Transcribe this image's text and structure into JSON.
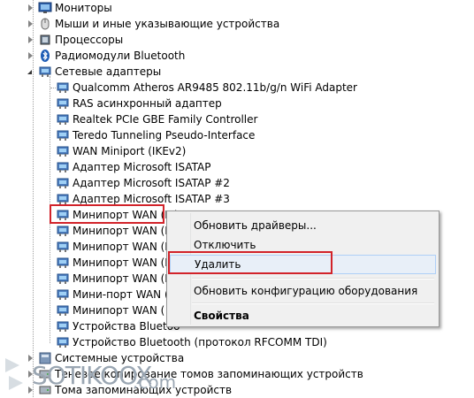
{
  "tree": {
    "categories_top": [
      {
        "label": "Мониторы",
        "icon": "monitor-icon"
      },
      {
        "label": "Мыши и иные указывающие устройства",
        "icon": "mouse-icon"
      },
      {
        "label": "Процессоры",
        "icon": "processor-icon"
      },
      {
        "label": "Радиомодули Bluetooth",
        "icon": "bluetooth-icon"
      },
      {
        "label": "Сетевые адаптеры",
        "icon": "network-adapter-icon"
      }
    ],
    "adapters": [
      "Qualcomm Atheros AR9485 802.11b/g/n WiFi Adapter",
      "RAS асинхронный адаптер",
      "Realtek PCIe GBE Family Controller",
      "Teredo Tunneling Pseudo-Interface",
      "WAN Miniport (IKEv2)",
      "Адаптер Microsoft ISATAP",
      "Адаптер Microsoft ISATAP #2",
      "Адаптер Microsoft ISATAP #3",
      "Минипорт WAN (IP)",
      "Минипорт WAN (I",
      "Минипорт WAN (L",
      "Минипорт WAN (P",
      "Минипорт WAN (P",
      "Мини-порт WAN (",
      "Минипорт WAN (",
      "Устройства Bluetoo",
      "Устройство Bluetooth (протокол RFCOMM TDI)"
    ],
    "categories_bottom": [
      {
        "label": "Системные устройства",
        "icon": "system-devices-icon"
      },
      {
        "label": "Теневое копирование томов запоминающих устройств",
        "icon": "storage-icon"
      },
      {
        "label": "Тома запоминающих устройств",
        "icon": "storage-volume-icon"
      }
    ]
  },
  "context_menu": {
    "update_drivers": "Обновить драйверы...",
    "disable": "Отключить",
    "uninstall": "Удалить",
    "scan_hardware": "Обновить конфигурацию оборудования",
    "properties": "Свойства"
  },
  "watermark": {
    "text": "SOTIKOOX",
    "suffix": ".com"
  },
  "colors": {
    "highlight_border": "#d2232a",
    "menu_bg": "#f0f0f0",
    "menu_hover": "#e8eff8"
  }
}
